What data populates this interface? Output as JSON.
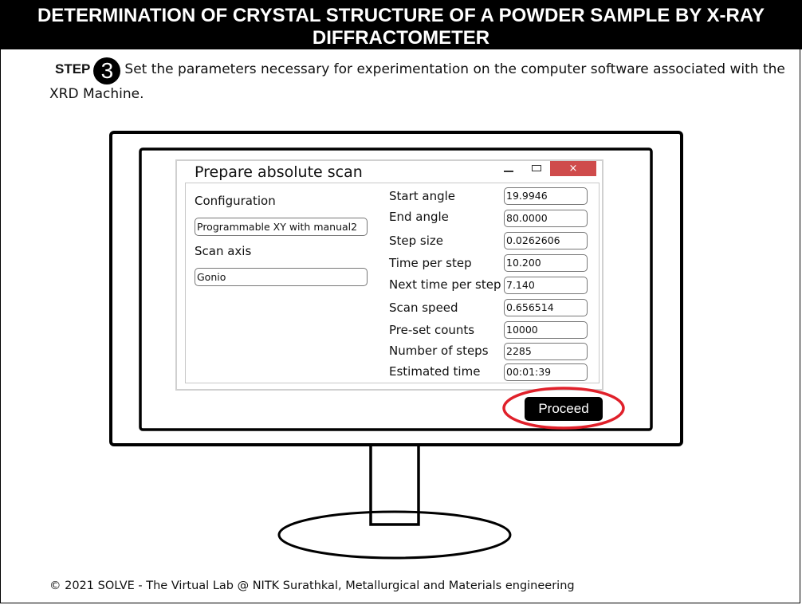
{
  "page": {
    "title": "DETERMINATION OF CRYSTAL STRUCTURE OF A POWDER SAMPLE BY X-RAY DIFFRACTOMETER",
    "footer": "© 2021 SOLVE - The Virtual Lab @ NITK Surathkal, Metallurgical and Materials engineering"
  },
  "step": {
    "label": "STEP",
    "number": "3",
    "instruction": "Set the parameters necessary for experimentation on the computer software associated with the XRD Machine."
  },
  "dialog": {
    "title": "Prepare absolute scan",
    "close_symbol": "×",
    "configuration_label": "Configuration",
    "configuration_value": "Programmable XY with manual2",
    "scan_axis_label": "Scan axis",
    "scan_axis_value": "Gonio",
    "parameters": [
      {
        "label": "Start angle",
        "value": "19.9946"
      },
      {
        "label": "End angle",
        "value": "80.0000"
      },
      {
        "label": "Step size",
        "value": "0.0262606"
      },
      {
        "label": "Time per step",
        "value": "10.200"
      },
      {
        "label": "Next time per step",
        "value": "7.140"
      },
      {
        "label": "Scan speed",
        "value": "0.656514"
      },
      {
        "label": "Pre-set counts",
        "value": "10000"
      },
      {
        "label": "Number of steps",
        "value": "2285"
      },
      {
        "label": "Estimated time",
        "value": "00:01:39"
      }
    ]
  },
  "actions": {
    "proceed_label": "Proceed"
  },
  "colors": {
    "highlight_ring": "#e0202a",
    "close_button": "#cf4b4b",
    "banner": "#000000"
  }
}
